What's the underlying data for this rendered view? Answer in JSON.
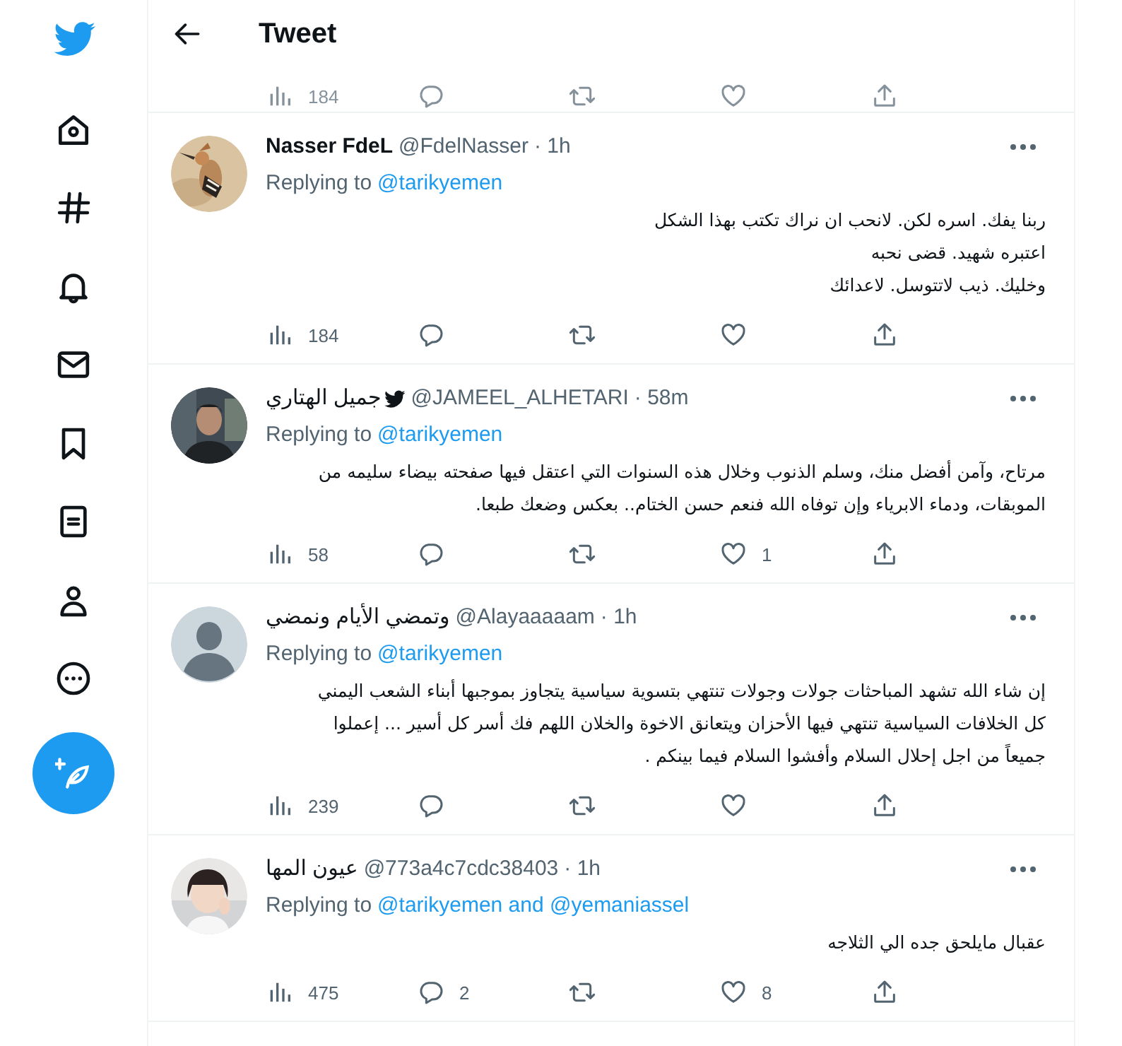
{
  "sidebar": {
    "items": [
      {
        "kind": "logo"
      },
      {
        "kind": "home"
      },
      {
        "kind": "explore"
      },
      {
        "kind": "notifications"
      },
      {
        "kind": "messages"
      },
      {
        "kind": "bookmarks"
      },
      {
        "kind": "lists"
      },
      {
        "kind": "profile"
      },
      {
        "kind": "more"
      },
      {
        "kind": "compose"
      }
    ]
  },
  "header": {
    "title": "Tweet"
  },
  "partial_tweet": {
    "counts": {
      "views": "184"
    }
  },
  "tweets": [
    {
      "name": "Nasser FdeL",
      "verified_bird": false,
      "handle": "@FdelNasser",
      "time": "· 1h",
      "reply": {
        "label": "Replying to",
        "mentions": "@tarikyemen"
      },
      "text": "ربنا يفك. اسره لكن.  لانحب ان نراك تكتب بهذا الشكل\nاعتبره شهيد.  قضى نحبه\nوخليك. ذيب لاتتوسل. لاعدائك",
      "counts": {
        "views": "184"
      }
    },
    {
      "name": "جميل الهتاري",
      "verified_bird": true,
      "handle": "@JAMEEL_ALHETARI",
      "time": "· 58m",
      "reply": {
        "label": "Replying to",
        "mentions": "@tarikyemen"
      },
      "text": "مرتاح، وآمن أفضل منك، وسلم الذنوب وخلال هذه السنوات التي اعتقل فيها صفحته بيضاء سليمه من\nالموبقات، ودماء الابرياء وإن توفاه الله فنعم حسن الختام.. بعكس وضعك طبعا.",
      "counts": {
        "views": "58",
        "like": "1"
      }
    },
    {
      "avatar": {
        "kind": "default"
      },
      "name": "وتمضي الأيام ونمضي",
      "verified_bird": false,
      "handle": "@Alayaaaaam",
      "time": "· 1h",
      "reply": {
        "label": "Replying to",
        "mentions": "@tarikyemen"
      },
      "text": "إن شاء الله  تشهد المباحثات جولات وجولات تنتهي بتسوية سياسية يتجاوز بموجبها أبناء الشعب اليمني\nكل الخلافات السياسية تنتهي فيها الأحزان ويتعانق الاخوة والخلان  اللهم فك أسر كل أسير  ... إعملوا\nجميعاً من اجل إحلال السلام وأفشوا السلام فيما بينكم  .",
      "counts": {
        "views": "239"
      }
    },
    {
      "name": "عيون المها",
      "verified_bird": false,
      "handle": "@773a4c7cdc38403",
      "time": "· 1h",
      "reply": {
        "label": "Replying to",
        "mentions": "@tarikyemen and @yemaniassel"
      },
      "text": "عقبال مايلحق جده الي الثلاجه",
      "counts": {
        "views": "475",
        "reply": "2",
        "like": "8"
      }
    }
  ]
}
